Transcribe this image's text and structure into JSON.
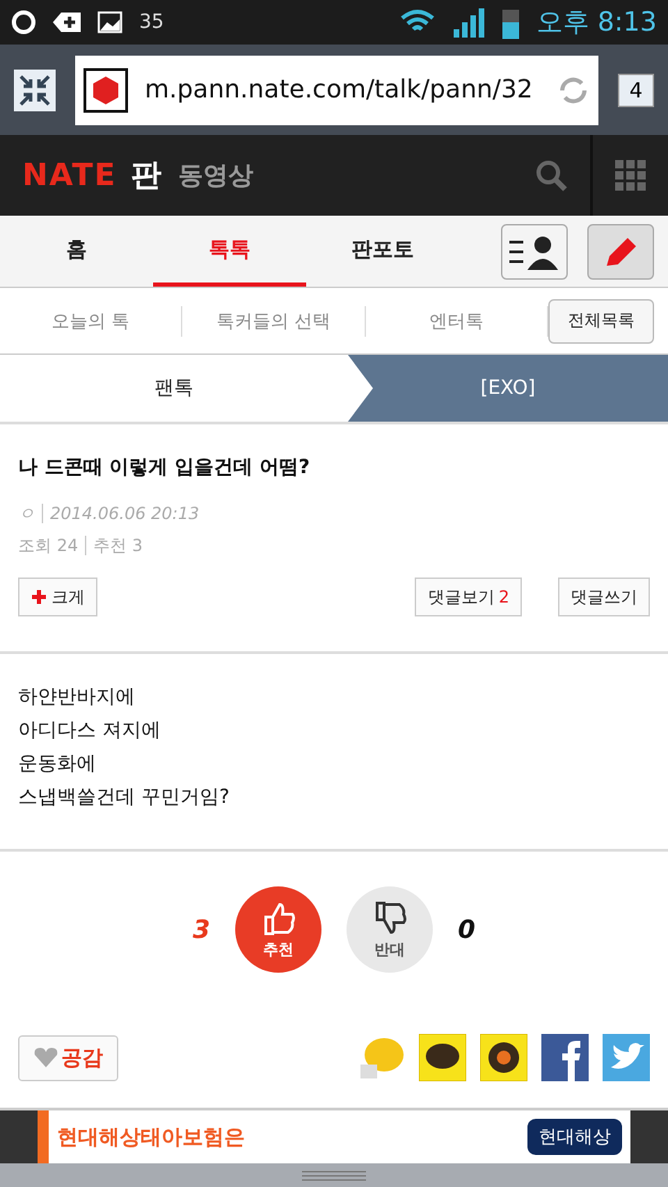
{
  "status_bar": {
    "notification_count": "35",
    "time": "오후 8:13"
  },
  "browser": {
    "url": "m.pann.nate.com/talk/pann/32",
    "tab_count": "4"
  },
  "header": {
    "logo": "NATE",
    "section": "판",
    "link": "동영상"
  },
  "tabs": [
    {
      "label": "홈",
      "selected": false
    },
    {
      "label": "톡톡",
      "selected": true
    },
    {
      "label": "판포토",
      "selected": false
    }
  ],
  "subnav": {
    "items": [
      "오늘의 톡",
      "톡커들의 선택",
      "엔터톡"
    ],
    "all_button": "전체목록"
  },
  "breadcrumb": [
    "팬톡",
    "[EXO]"
  ],
  "post": {
    "title": "나 드콘때 이렇게 입을건데 어떰?",
    "author": "ㅇ",
    "date": "2014.06.06 20:13",
    "views": "조회 24",
    "recommends": "추천 3",
    "enlarge": "크게",
    "view_comments": "댓글보기",
    "comment_count": "2",
    "write_comment": "댓글쓰기"
  },
  "body": [
    "하얀반바지에",
    "아디다스 져지에",
    "운동화에",
    "스냅백쓸건데 꾸민거임?"
  ],
  "votes": {
    "up_count": "3",
    "up_label": "추천",
    "down_label": "반대",
    "down_count": "0"
  },
  "empathy": "공감",
  "ad": {
    "headline": "현대해상태아보험은",
    "badge": "현대해상"
  }
}
